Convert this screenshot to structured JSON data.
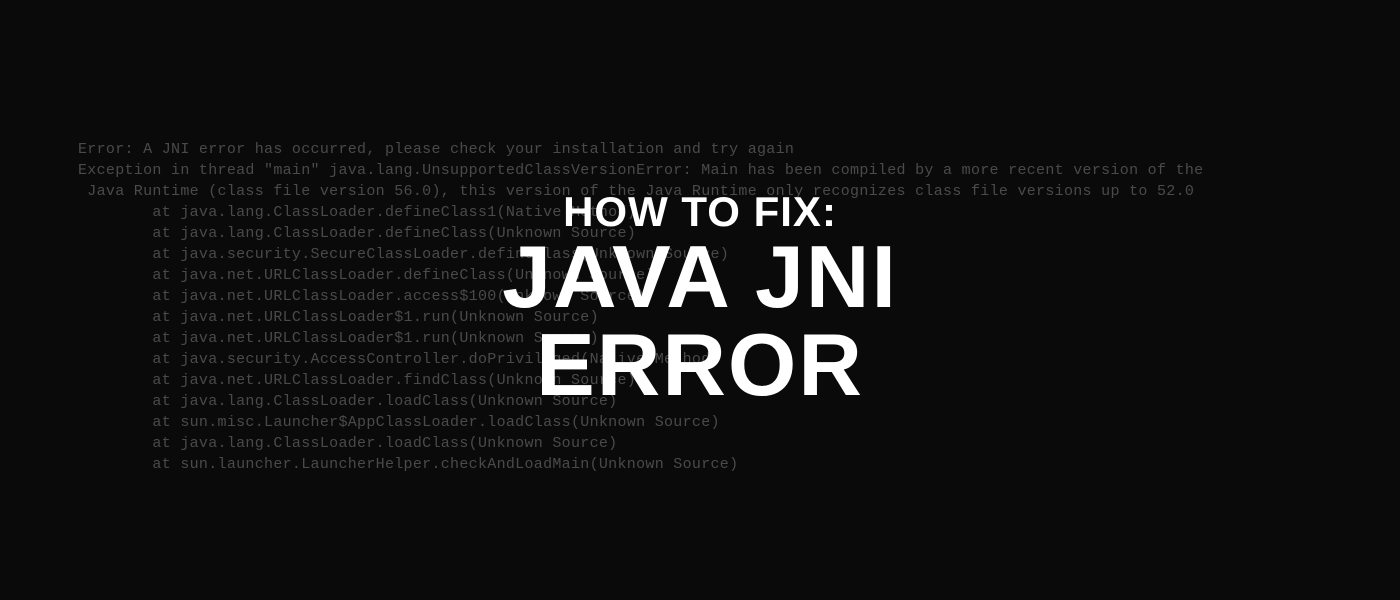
{
  "console": {
    "line1": "Error: A JNI error has occurred, please check your installation and try again",
    "line2": "Exception in thread \"main\" java.lang.UnsupportedClassVersionError: Main has been compiled by a more recent version of the",
    "line3": " Java Runtime (class file version 56.0), this version of the Java Runtime only recognizes class file versions up to 52.0",
    "stack1": "        at java.lang.ClassLoader.defineClass1(Native Method)",
    "stack2": "        at java.lang.ClassLoader.defineClass(Unknown Source)",
    "stack3": "        at java.security.SecureClassLoader.defineClass(Unknown Source)",
    "stack4": "        at java.net.URLClassLoader.defineClass(Unknown Source)",
    "stack5": "        at java.net.URLClassLoader.access$100(Unknown Source)",
    "stack6": "        at java.net.URLClassLoader$1.run(Unknown Source)",
    "stack7": "        at java.net.URLClassLoader$1.run(Unknown Source)",
    "stack8": "        at java.security.AccessController.doPrivileged(Native Method)",
    "stack9": "        at java.net.URLClassLoader.findClass(Unknown Source)",
    "stack10": "        at java.lang.ClassLoader.loadClass(Unknown Source)",
    "stack11": "        at sun.misc.Launcher$AppClassLoader.loadClass(Unknown Source)",
    "stack12": "        at java.lang.ClassLoader.loadClass(Unknown Source)",
    "stack13": "        at sun.launcher.LauncherHelper.checkAndLoadMain(Unknown Source)"
  },
  "title": {
    "subtitle": "HOW TO FIX:",
    "main": "JAVA JNI ERROR"
  }
}
